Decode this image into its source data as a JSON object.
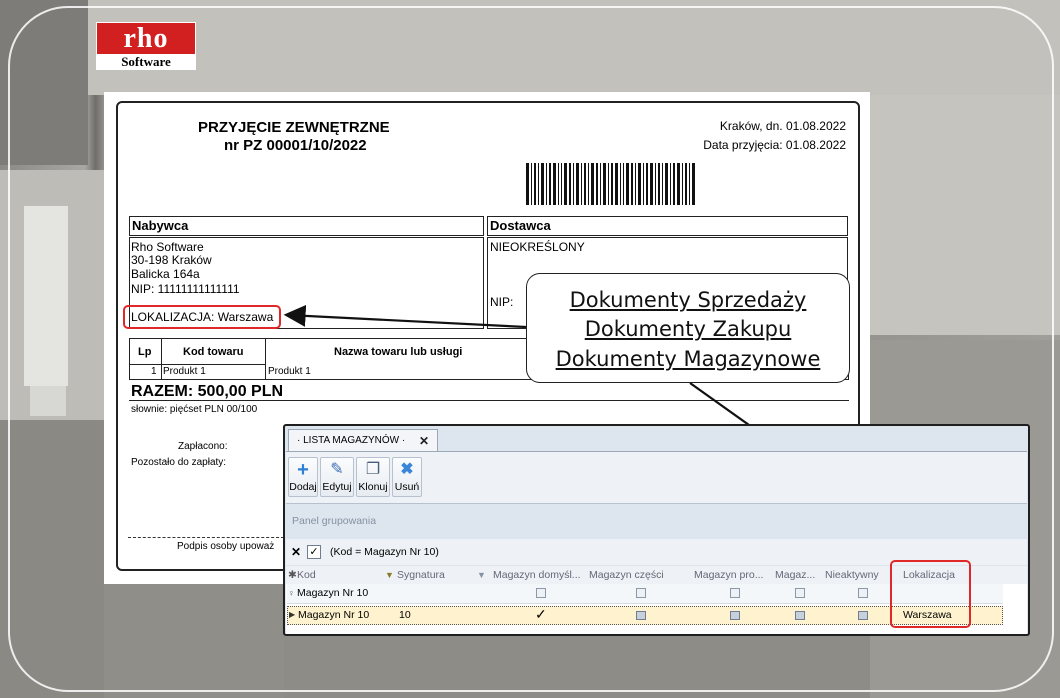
{
  "logo": {
    "brand": "rho",
    "subtitle": "Software"
  },
  "document": {
    "title": "PRZYJĘCIE ZEWNĘTRZNE",
    "number": "nr PZ 00001/10/2022",
    "place_date": "Kraków, dn. 01.08.2022",
    "receipt_date": "Data przyjęcia: 01.08.2022",
    "buyer": {
      "header": "Nabywca",
      "lines": [
        "Rho Software",
        "30-198 Kraków",
        "Balicka 164a",
        "NIP: 11111111111111"
      ],
      "location": "LOKALIZACJA: Warszawa"
    },
    "supplier": {
      "header": "Dostawca",
      "name": "NIEOKREŚLONY",
      "nip": "NIP:"
    },
    "table": {
      "headers": [
        "Lp",
        "Kod towaru",
        "Nazwa towaru lub usługi"
      ],
      "rows": [
        [
          "1",
          "Produkt 1",
          "Produkt 1"
        ]
      ]
    },
    "total": "RAZEM: 500,00 PLN",
    "in_words": "słownie:  pięćset  PLN 00/100",
    "paid_label": "Zapłacono:",
    "remaining_label": "Pozostało do zapłaty:",
    "signature": "Podpis osoby upoważ"
  },
  "callout": {
    "lines": [
      "Dokumenty Sprzedaży",
      "Dokumenty Zakupu",
      "Dokumenty Magazynowe"
    ]
  },
  "window": {
    "tab_title": "· LISTA MAGAZYNÓW ·",
    "tab_close": "✕",
    "toolbar": [
      {
        "label": "Dodaj",
        "icon": "plus-icon",
        "color": "#2f7fd6"
      },
      {
        "label": "Edytuj",
        "icon": "pencil-icon",
        "color": "#3b6fb6"
      },
      {
        "label": "Klonuj",
        "icon": "copy-icon",
        "color": "#4a5d78"
      },
      {
        "label": "Usuń",
        "icon": "delete-icon",
        "color": "#3a86d8"
      }
    ],
    "group_panel": "Panel grupowania",
    "filter_text": "(Kod = Magazyn Nr 10)",
    "columns": [
      "Kod",
      "Sygnatura",
      "Magazyn domyśl...",
      "Magazyn części",
      "Magazyn pro...",
      "Magaz...",
      "Nieaktywny",
      "Lokalizacja"
    ],
    "filter_row": {
      "kod": "Magazyn Nr 10"
    },
    "rows": [
      {
        "kod": "Magazyn Nr 10",
        "sygnatura": "10",
        "domyslny": true,
        "lokalizacja": "Warszawa"
      }
    ]
  },
  "colors": {
    "accent_red": "#e12828",
    "selected_row": "#fff3cf",
    "logo_red": "#d21f1f"
  }
}
